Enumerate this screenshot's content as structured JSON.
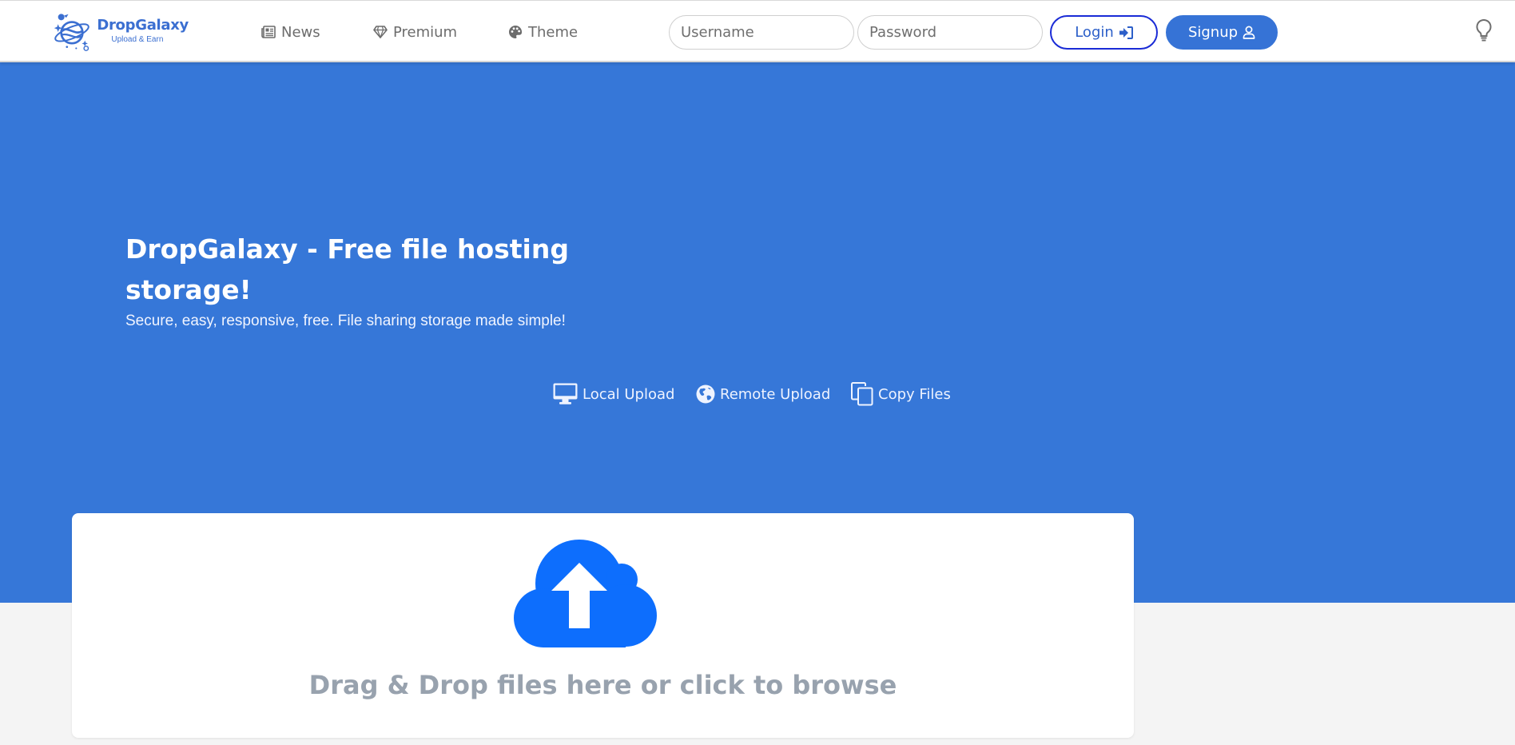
{
  "brand": {
    "name": "DropGalaxy",
    "tagline": "Upload & Earn",
    "color": "#3b6fd1"
  },
  "nav": {
    "items": [
      {
        "label": "News",
        "icon": "newspaper-icon"
      },
      {
        "label": "Premium",
        "icon": "gem-icon"
      },
      {
        "label": "Theme",
        "icon": "palette-icon"
      }
    ]
  },
  "auth": {
    "username_placeholder": "Username",
    "password_placeholder": "Password",
    "login_label": "Login",
    "signup_label": "Signup"
  },
  "hero": {
    "title": "DropGalaxy - Free file hosting storage!",
    "subtitle": "Secure, easy, responsive, free. File sharing storage made simple!",
    "background": "#3677d8",
    "tabs": [
      {
        "label": "Local Upload",
        "icon": "desktop-icon"
      },
      {
        "label": "Remote Upload",
        "icon": "globe-icon"
      },
      {
        "label": "Copy Files",
        "icon": "copy-icon"
      }
    ]
  },
  "upload": {
    "prompt": "Drag & Drop files here or click to browse",
    "icon": "cloud-upload-icon",
    "icon_color": "#0d6efd"
  },
  "colors": {
    "accent": "#3673d6",
    "login_border": "#1a2bd6"
  }
}
